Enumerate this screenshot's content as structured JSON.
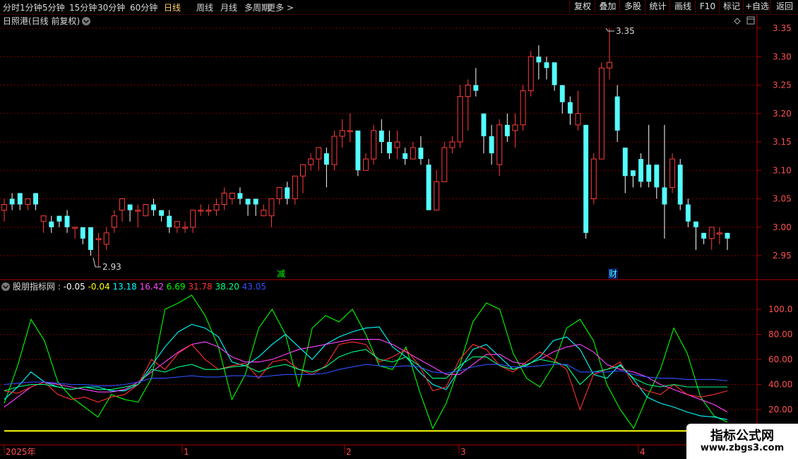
{
  "toolbar": {
    "periods": [
      "分时",
      "1分钟",
      "5分钟",
      "15分钟",
      "30分钟",
      "60分钟",
      "日线",
      "周线",
      "月线",
      "多周期",
      "更多 >"
    ],
    "active_period": "日线",
    "right_buttons": [
      "复权",
      "叠加",
      "多股",
      "统计",
      "画线",
      "F10",
      "标记",
      "+自选",
      "返回"
    ]
  },
  "main_chart": {
    "title": "日照港(日线 前复权)",
    "y_ticks": [
      "3.35",
      "3.30",
      "3.25",
      "3.20",
      "3.15",
      "3.10",
      "3.05",
      "3.00",
      "2.95"
    ],
    "annotation_high": "3.35",
    "annotation_low": "2.93",
    "marker_left": "减",
    "marker_right": "财"
  },
  "indicator": {
    "name": "股朋指标网",
    "values": [
      {
        "text": "-0.05",
        "color": "#ffffff"
      },
      {
        "text": "-0.04",
        "color": "#ffff00"
      },
      {
        "text": "13.18",
        "color": "#00ffff"
      },
      {
        "text": "16.42",
        "color": "#ff44ff"
      },
      {
        "text": "6.69",
        "color": "#00ff00"
      },
      {
        "text": "31.78",
        "color": "#ff3030"
      },
      {
        "text": "38.20",
        "color": "#00ff80"
      },
      {
        "text": "43.05",
        "color": "#3050ff"
      }
    ],
    "y_ticks": [
      "100.0",
      "80.00",
      "60.00",
      "40.00",
      "20.00"
    ]
  },
  "time_axis": {
    "labels": [
      "2025年",
      "1",
      "2",
      "3",
      "4"
    ]
  },
  "watermark": {
    "title": "指标公式网",
    "url": "www.zbgs3.com"
  },
  "colors": {
    "up": "#ff3c3c",
    "down": "#54ffff",
    "frame": "#aa0000",
    "grid": "#7a0000"
  },
  "chart_data": [
    {
      "type": "candlestick",
      "title": "日照港(日线 前复权)",
      "ylim": [
        2.92,
        3.37
      ],
      "y_ticks": [
        3.35,
        3.3,
        3.25,
        3.2,
        3.15,
        3.1,
        3.05,
        3.0,
        2.95
      ],
      "high_label": 3.35,
      "low_label": 2.93,
      "candles": [
        [
          3.03,
          3.04,
          3.05,
          3.01
        ],
        [
          3.05,
          3.04,
          3.06,
          3.03
        ],
        [
          3.06,
          3.04,
          3.06,
          3.03
        ],
        [
          3.04,
          3.05,
          3.05,
          3.03
        ],
        [
          3.06,
          3.04,
          3.06,
          3.03
        ],
        [
          3.01,
          3.02,
          3.02,
          2.99
        ],
        [
          3.01,
          3.0,
          3.02,
          2.99
        ],
        [
          3.02,
          3.01,
          3.02,
          3.0
        ],
        [
          3.02,
          3.0,
          3.03,
          2.99
        ],
        [
          3.0,
          3.0,
          3.0,
          2.98
        ],
        [
          3.0,
          2.98,
          3.0,
          2.97
        ],
        [
          3.0,
          2.96,
          3.0,
          2.95
        ],
        [
          2.98,
          2.98,
          2.99,
          2.93
        ],
        [
          2.97,
          2.99,
          3.0,
          2.96
        ],
        [
          3.0,
          3.02,
          3.03,
          2.99
        ],
        [
          3.03,
          3.05,
          3.05,
          3.01
        ],
        [
          3.04,
          3.03,
          3.04,
          3.01
        ],
        [
          3.03,
          3.03,
          3.04,
          3.0
        ],
        [
          3.02,
          3.04,
          3.04,
          3.02
        ],
        [
          3.04,
          3.03,
          3.05,
          3.02
        ],
        [
          3.03,
          3.02,
          3.03,
          3.01
        ],
        [
          3.02,
          3.0,
          3.03,
          2.99
        ],
        [
          3.0,
          3.01,
          3.01,
          2.99
        ],
        [
          3.0,
          3.0,
          3.01,
          2.99
        ],
        [
          3.0,
          3.03,
          3.03,
          2.99
        ],
        [
          3.03,
          3.03,
          3.04,
          3.02
        ],
        [
          3.03,
          3.03,
          3.04,
          3.02
        ],
        [
          3.03,
          3.04,
          3.05,
          3.02
        ],
        [
          3.04,
          3.06,
          3.07,
          3.03
        ],
        [
          3.05,
          3.06,
          3.06,
          3.04
        ],
        [
          3.06,
          3.05,
          3.07,
          3.04
        ],
        [
          3.05,
          3.04,
          3.05,
          3.02
        ],
        [
          3.05,
          3.04,
          3.05,
          3.02
        ],
        [
          3.02,
          3.03,
          3.04,
          3.02
        ],
        [
          3.02,
          3.05,
          3.05,
          3.0
        ],
        [
          3.05,
          3.07,
          3.07,
          3.04
        ],
        [
          3.07,
          3.05,
          3.08,
          3.04
        ],
        [
          3.05,
          3.09,
          3.09,
          3.04
        ],
        [
          3.09,
          3.11,
          3.11,
          3.06
        ],
        [
          3.11,
          3.12,
          3.13,
          3.1
        ],
        [
          3.12,
          3.14,
          3.14,
          3.1
        ],
        [
          3.13,
          3.11,
          3.14,
          3.07
        ],
        [
          3.11,
          3.16,
          3.17,
          3.1
        ],
        [
          3.16,
          3.17,
          3.19,
          3.14
        ],
        [
          3.17,
          3.17,
          3.2,
          3.15
        ],
        [
          3.17,
          3.1,
          3.17,
          3.09
        ],
        [
          3.1,
          3.12,
          3.13,
          3.1
        ],
        [
          3.12,
          3.17,
          3.18,
          3.11
        ],
        [
          3.17,
          3.15,
          3.19,
          3.13
        ],
        [
          3.15,
          3.13,
          3.17,
          3.12
        ],
        [
          3.14,
          3.15,
          3.17,
          3.12
        ],
        [
          3.13,
          3.12,
          3.14,
          3.11
        ],
        [
          3.12,
          3.14,
          3.15,
          3.12
        ],
        [
          3.14,
          3.12,
          3.16,
          3.11
        ],
        [
          3.11,
          3.03,
          3.12,
          3.03
        ],
        [
          3.03,
          3.08,
          3.1,
          3.03
        ],
        [
          3.08,
          3.14,
          3.15,
          3.08
        ],
        [
          3.14,
          3.15,
          3.16,
          3.13
        ],
        [
          3.15,
          3.23,
          3.25,
          3.14
        ],
        [
          3.23,
          3.25,
          3.26,
          3.17
        ],
        [
          3.25,
          3.24,
          3.28,
          3.23
        ],
        [
          3.2,
          3.16,
          3.2,
          3.13
        ],
        [
          3.16,
          3.13,
          3.18,
          3.11
        ],
        [
          3.11,
          3.18,
          3.19,
          3.09
        ],
        [
          3.18,
          3.16,
          3.2,
          3.15
        ],
        [
          3.17,
          3.18,
          3.2,
          3.14
        ],
        [
          3.18,
          3.24,
          3.25,
          3.17
        ],
        [
          3.24,
          3.3,
          3.31,
          3.23
        ],
        [
          3.3,
          3.29,
          3.32,
          3.26
        ],
        [
          3.29,
          3.28,
          3.3,
          3.26
        ],
        [
          3.29,
          3.25,
          3.29,
          3.24
        ],
        [
          3.25,
          3.22,
          3.25,
          3.2
        ],
        [
          3.22,
          3.2,
          3.23,
          3.18
        ],
        [
          3.18,
          3.2,
          3.24,
          3.17
        ],
        [
          3.18,
          2.99,
          3.18,
          2.98
        ],
        [
          3.05,
          3.12,
          3.13,
          3.04
        ],
        [
          3.12,
          3.28,
          3.29,
          3.12
        ],
        [
          3.28,
          3.29,
          3.35,
          3.26
        ],
        [
          3.23,
          3.17,
          3.25,
          3.15
        ],
        [
          3.14,
          3.09,
          3.14,
          3.06
        ],
        [
          3.1,
          3.09,
          3.1,
          3.07
        ],
        [
          3.12,
          3.08,
          3.13,
          3.07
        ],
        [
          3.11,
          3.08,
          3.18,
          3.07
        ],
        [
          3.11,
          3.07,
          3.11,
          3.05
        ],
        [
          3.07,
          3.04,
          3.18,
          2.98
        ],
        [
          3.07,
          3.12,
          3.13,
          3.06
        ],
        [
          3.11,
          3.04,
          3.12,
          3.03
        ],
        [
          3.04,
          3.01,
          3.05,
          3.0
        ],
        [
          3.01,
          3.0,
          3.01,
          2.96
        ],
        [
          2.99,
          2.98,
          2.99,
          2.97
        ],
        [
          2.98,
          3.0,
          3.0,
          2.96
        ],
        [
          2.99,
          2.99,
          3.0,
          2.97
        ],
        [
          2.99,
          2.98,
          2.99,
          2.96
        ]
      ]
    },
    {
      "type": "line",
      "name": "股朋指标网",
      "ylim": [
        0,
        120
      ],
      "y_ticks": [
        100,
        80,
        60,
        40,
        20
      ],
      "x_count": 46,
      "baseline": 0,
      "series": [
        {
          "color": "#00ff00",
          "values": [
            25,
            55,
            92,
            75,
            42,
            30,
            22,
            14,
            32,
            28,
            26,
            45,
            100,
            105,
            112,
            95,
            70,
            28,
            48,
            85,
            100,
            80,
            38,
            85,
            95,
            90,
            100,
            80,
            55,
            52,
            70,
            35,
            5,
            25,
            55,
            90,
            105,
            100,
            65,
            45,
            38,
            55,
            85,
            92,
            75,
            40,
            20,
            5,
            30,
            52,
            85,
            65,
            30,
            15,
            10
          ]
        },
        {
          "color": "#00ffff",
          "values": [
            28,
            38,
            50,
            42,
            38,
            36,
            38,
            38,
            35,
            35,
            40,
            55,
            70,
            82,
            88,
            85,
            78,
            58,
            55,
            62,
            72,
            80,
            70,
            60,
            72,
            78,
            82,
            85,
            86,
            70,
            62,
            50,
            40,
            36,
            52,
            68,
            72,
            62,
            52,
            55,
            62,
            75,
            78,
            68,
            48,
            45,
            56,
            44,
            30,
            25,
            22,
            18,
            15,
            14,
            12
          ]
        },
        {
          "color": "#ff44ff",
          "values": [
            22,
            30,
            38,
            42,
            40,
            38,
            36,
            34,
            34,
            36,
            42,
            50,
            58,
            66,
            72,
            74,
            70,
            62,
            58,
            58,
            60,
            64,
            68,
            70,
            72,
            74,
            76,
            76,
            76,
            72,
            66,
            60,
            54,
            48,
            48,
            56,
            64,
            64,
            58,
            56,
            60,
            66,
            70,
            72,
            66,
            56,
            52,
            50,
            46,
            40,
            36,
            32,
            28,
            24,
            18
          ]
        },
        {
          "color": "#ff3030",
          "values": [
            35,
            33,
            38,
            42,
            32,
            28,
            30,
            26,
            30,
            32,
            40,
            60,
            52,
            65,
            72,
            60,
            52,
            55,
            57,
            45,
            58,
            60,
            52,
            48,
            55,
            72,
            74,
            72,
            58,
            62,
            68,
            55,
            35,
            38,
            60,
            72,
            68,
            55,
            50,
            58,
            66,
            60,
            52,
            20,
            48,
            52,
            58,
            40,
            35,
            32,
            40,
            32,
            30,
            32,
            35
          ]
        },
        {
          "color": "#00ff80",
          "values": [
            35,
            38,
            40,
            40,
            38,
            36,
            38,
            36,
            36,
            38,
            40,
            52,
            50,
            54,
            56,
            52,
            52,
            54,
            55,
            50,
            54,
            56,
            52,
            50,
            54,
            62,
            66,
            68,
            60,
            58,
            62,
            55,
            45,
            45,
            55,
            62,
            62,
            55,
            52,
            56,
            60,
            58,
            55,
            40,
            50,
            52,
            55,
            45,
            40,
            38,
            40,
            38,
            38,
            38,
            38
          ]
        },
        {
          "color": "#3050ff",
          "values": [
            40,
            41,
            42,
            42,
            41,
            40,
            40,
            39,
            39,
            40,
            42,
            45,
            45,
            46,
            47,
            46,
            46,
            47,
            47,
            46,
            47,
            48,
            48,
            48,
            49,
            52,
            54,
            56,
            55,
            54,
            55,
            54,
            50,
            49,
            51,
            54,
            56,
            56,
            54,
            54,
            55,
            56,
            56,
            50,
            50,
            50,
            51,
            48,
            46,
            45,
            45,
            44,
            44,
            44,
            43
          ]
        },
        {
          "color": "#ffff00",
          "values": [
            3,
            3,
            3,
            3,
            3,
            3,
            3,
            3,
            3,
            3,
            3,
            3,
            3,
            3,
            3,
            3,
            3,
            3,
            3,
            3,
            3,
            3,
            3,
            3,
            3,
            3,
            3,
            3,
            3,
            3,
            3,
            3,
            3,
            3,
            3,
            3,
            3,
            3,
            3,
            3,
            3,
            3,
            3,
            3,
            3,
            3,
            3,
            3,
            3,
            3,
            3,
            3,
            3,
            3,
            3
          ]
        }
      ]
    }
  ]
}
